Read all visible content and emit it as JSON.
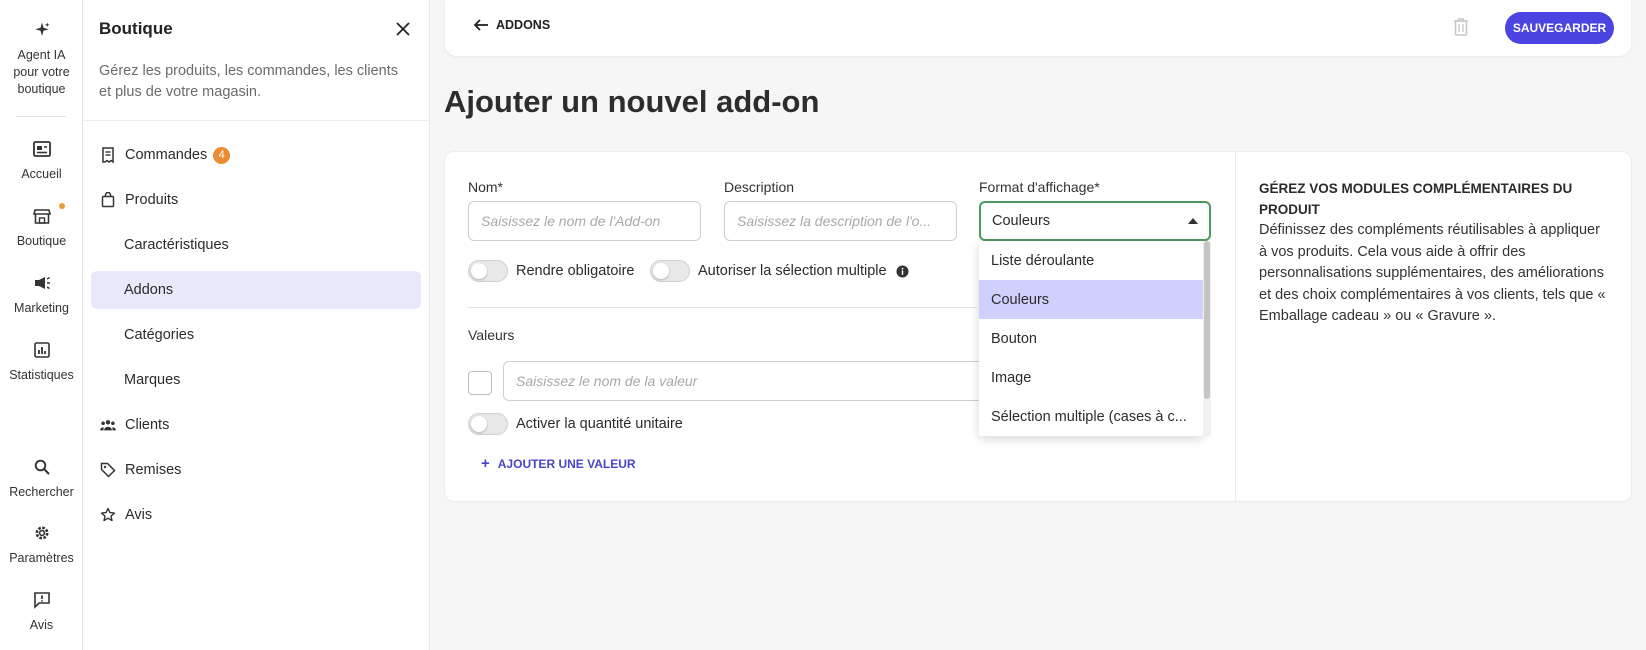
{
  "rail": {
    "items": [
      {
        "label": "Agent IA pour votre boutique",
        "icon": "sparkle-icon"
      },
      {
        "label": "Accueil",
        "icon": "home-icon"
      },
      {
        "label": "Boutique",
        "icon": "store-icon"
      },
      {
        "label": "Marketing",
        "icon": "megaphone-icon"
      },
      {
        "label": "Statistiques",
        "icon": "chart-icon"
      },
      {
        "label": "Rechercher",
        "icon": "search-icon"
      },
      {
        "label": "Paramètres",
        "icon": "gear-icon"
      },
      {
        "label": "Avis",
        "icon": "feedback-icon"
      }
    ]
  },
  "panel": {
    "title": "Boutique",
    "description": "Gérez les produits, les commandes, les clients et plus de votre magasin.",
    "nav": [
      {
        "label": "Commandes",
        "badge": "4"
      },
      {
        "label": "Produits"
      },
      {
        "label": "Caractéristiques"
      },
      {
        "label": "Addons"
      },
      {
        "label": "Catégories"
      },
      {
        "label": "Marques"
      },
      {
        "label": "Clients"
      },
      {
        "label": "Remises"
      },
      {
        "label": "Avis"
      }
    ]
  },
  "topbar": {
    "back_label": "ADDONS",
    "save_label": "SAUVEGARDER"
  },
  "page": {
    "title": "Ajouter un nouvel add-on"
  },
  "form": {
    "name_label": "Nom*",
    "name_placeholder": "Saisissez le nom de l'Add-on",
    "description_label": "Description",
    "description_placeholder": "Saisissez la description de l'o...",
    "format_label": "Format d'affichage*",
    "format_value": "Couleurs",
    "required_label": "Rendre obligatoire",
    "multi_label": "Autoriser la sélection multiple",
    "values_label": "Valeurs",
    "value_placeholder": "Saisissez le nom de la valeur",
    "unit_qty_label": "Activer la quantité unitaire",
    "add_value_label": "AJOUTER UNE VALEUR"
  },
  "dropdown": {
    "options": [
      "Liste déroulante",
      "Couleurs",
      "Bouton",
      "Image",
      "Sélection multiple (cases à c..."
    ],
    "selected": "Couleurs"
  },
  "info": {
    "title": "GÉREZ VOS MODULES COMPLÉMENTAIRES DU PRODUIT",
    "text": "Définissez des compléments réutilisables à appliquer à vos produits. Cela vous aide à offrir des personnalisations supplémentaires, des améliorations et des choix complémentaires à vos clients, tels que « Emballage cadeau » ou « Gravure »."
  },
  "colors": {
    "accent": "#4b44e0",
    "active_nav": "#e9e9fc",
    "badge": "#e88d34",
    "select_border": "#4a9a5e",
    "selected_option": "#cfd0fb"
  }
}
